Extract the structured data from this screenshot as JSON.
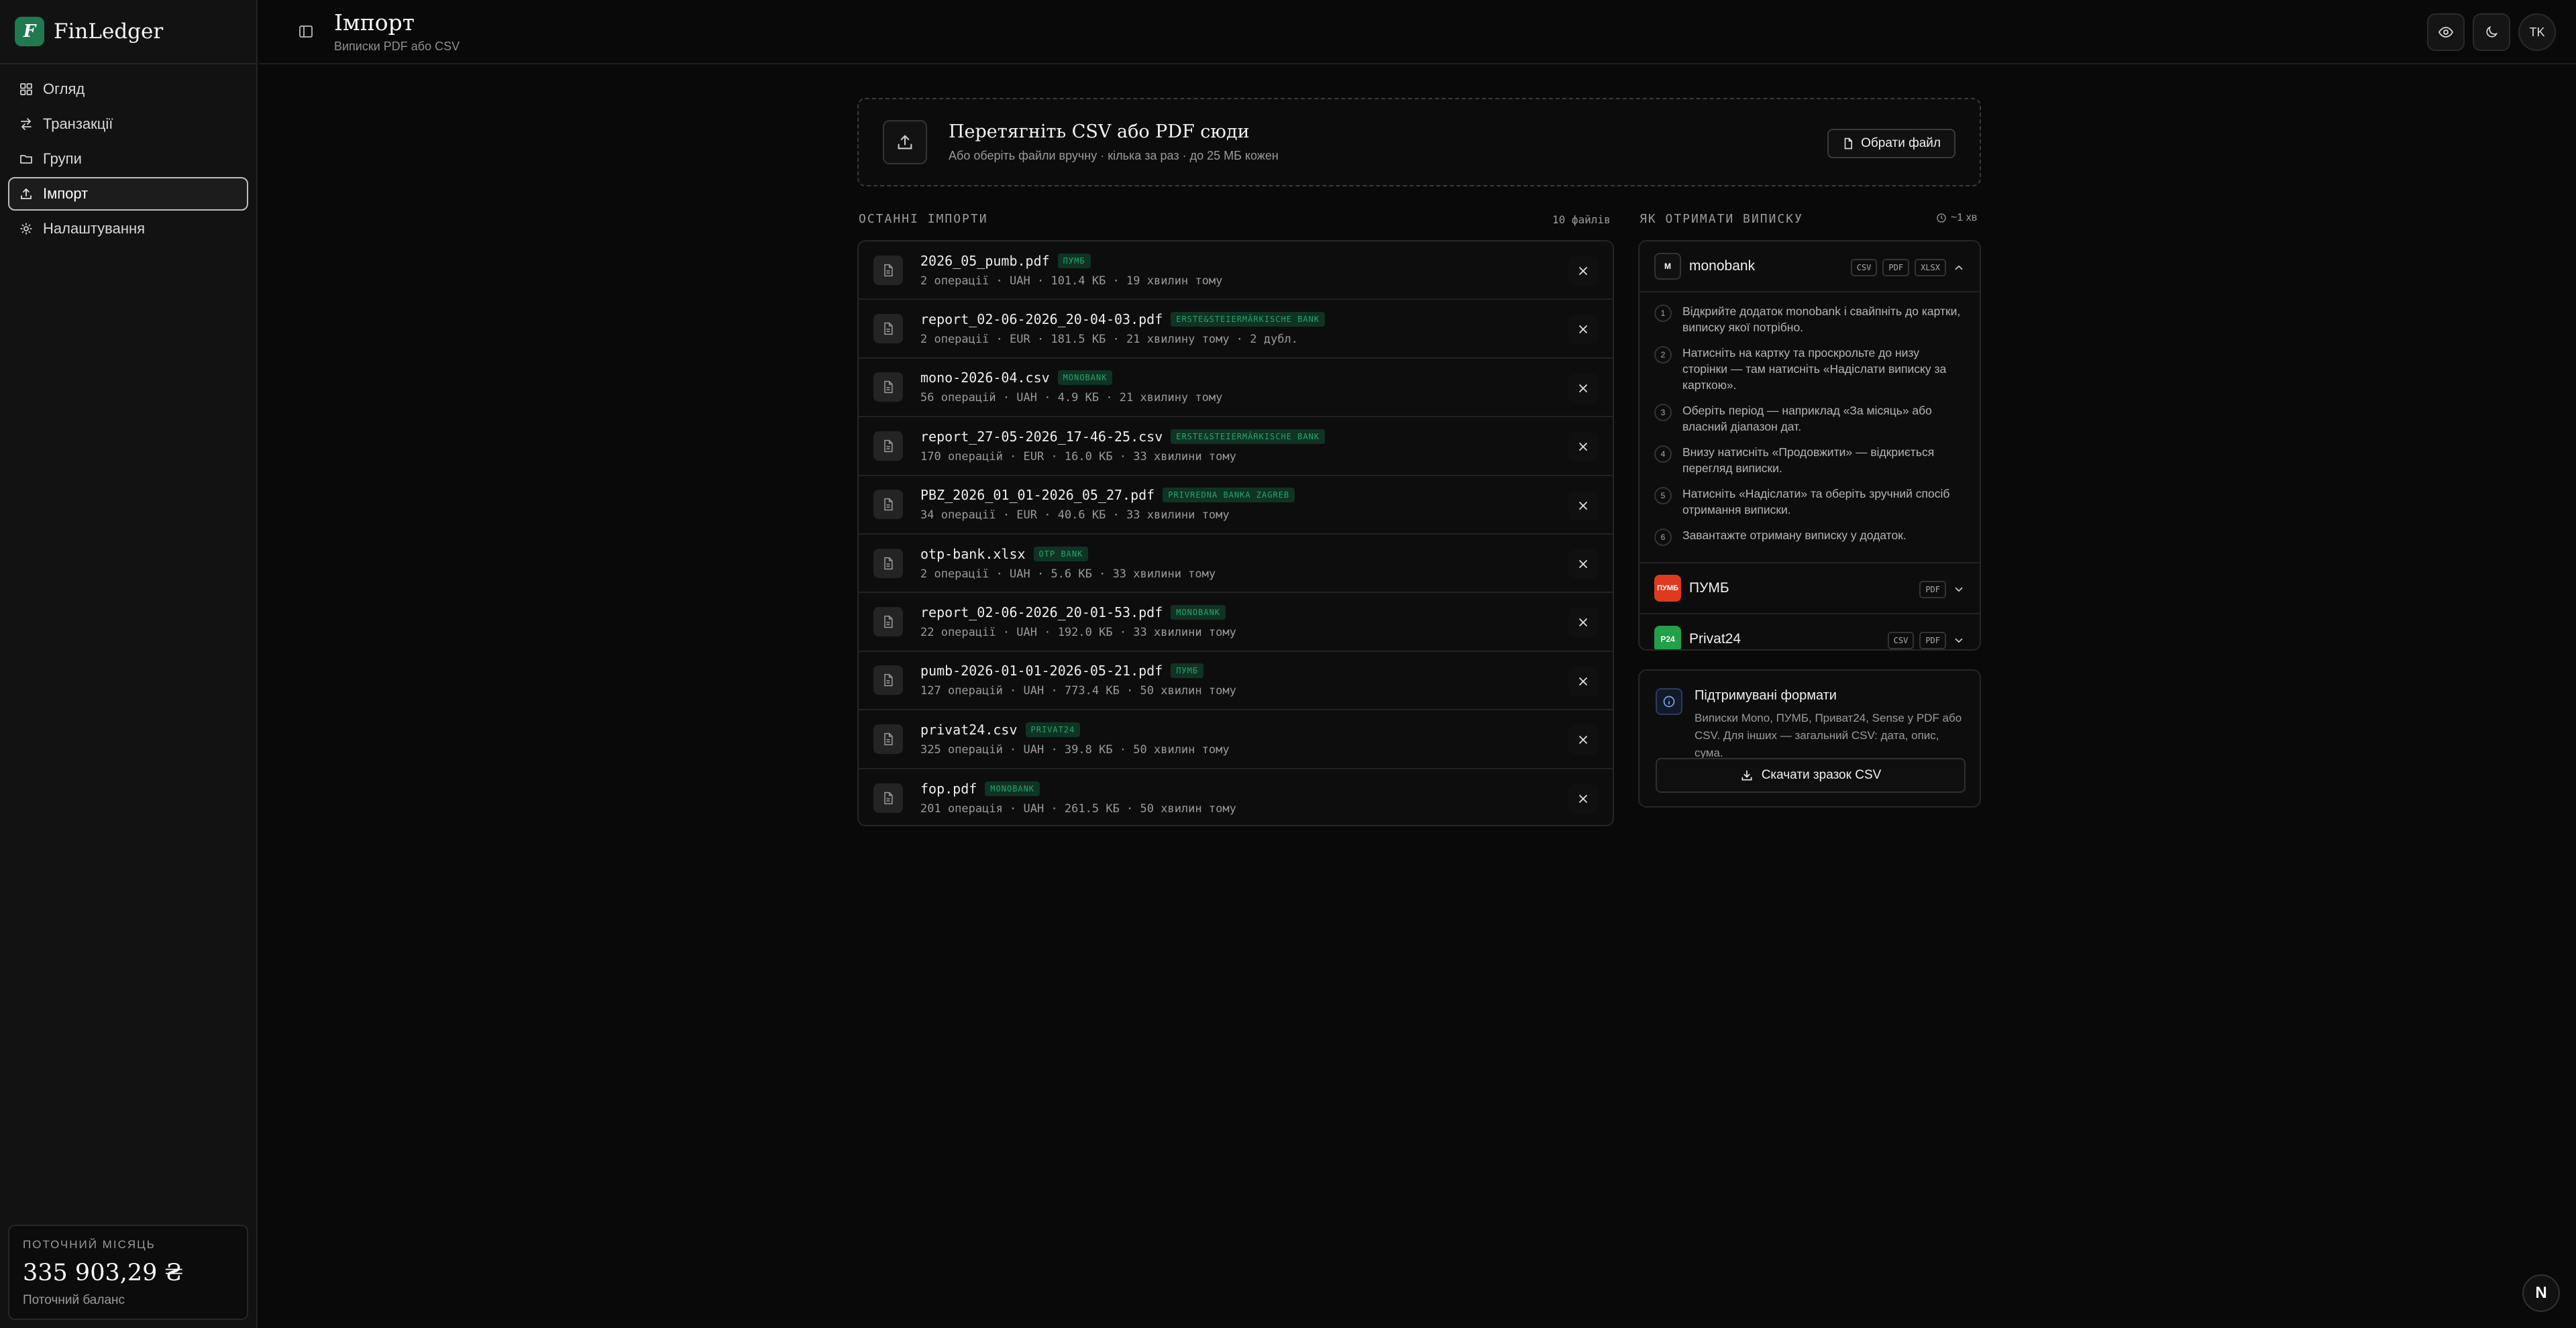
{
  "app": {
    "name": "FinLedger",
    "logo_letter": "F",
    "accent": "#1f7a4f"
  },
  "sidebar": {
    "items": [
      {
        "label": "Огляд",
        "icon": "grid-icon"
      },
      {
        "label": "Транзакції",
        "icon": "arrows-icon"
      },
      {
        "label": "Групи",
        "icon": "folder-icon"
      },
      {
        "label": "Імпорт",
        "icon": "upload-icon",
        "active": true
      },
      {
        "label": "Налаштування",
        "icon": "gear-icon"
      }
    ],
    "balance": {
      "label": "ПОТОЧНИЙ МІСЯЦЬ",
      "value": "335 903,29 ₴",
      "sub": "Поточний баланс"
    }
  },
  "header": {
    "title": "Імпорт",
    "subtitle": "Виписки PDF або CSV",
    "avatar": "TK"
  },
  "dropzone": {
    "title": "Перетягніть CSV або PDF сюди",
    "subtitle": "Або оберіть файли вручну · кілька за раз · до 25 МБ кожен",
    "button": "Обрати файл"
  },
  "imports": {
    "label": "ОСТАННІ ІМПОРТИ",
    "count": "10 файлів",
    "rows": [
      {
        "name": "2026_05_pumb.pdf",
        "badge": "ПУМБ",
        "meta": "2 операції · UAH · 101.4 КБ · 19 хвилин тому"
      },
      {
        "name": "report_02-06-2026_20-04-03.pdf",
        "badge": "ERSTE&STEIERMÄRKISCHE BANK",
        "meta": "2 операції · EUR · 181.5 КБ · 21 хвилину тому · 2 дубл."
      },
      {
        "name": "mono-2026-04.csv",
        "badge": "MONOBANK",
        "meta": "56 операцій · UAH · 4.9 КБ · 21 хвилину тому"
      },
      {
        "name": "report_27-05-2026_17-46-25.csv",
        "badge": "ERSTE&STEIERMÄRKISCHE BANK",
        "meta": "170 операцій · EUR · 16.0 КБ · 33 хвилини тому"
      },
      {
        "name": "PBZ_2026_01_01-2026_05_27.pdf",
        "badge": "PRIVREDNA BANKA ZAGREB",
        "meta": "34 операції · EUR · 40.6 КБ · 33 хвилини тому"
      },
      {
        "name": "otp-bank.xlsx",
        "badge": "OTP BANK",
        "meta": "2 операції · UAH · 5.6 КБ · 33 хвилини тому"
      },
      {
        "name": "report_02-06-2026_20-01-53.pdf",
        "badge": "MONOBANK",
        "meta": "22 операції · UAH · 192.0 КБ · 33 хвилини тому"
      },
      {
        "name": "pumb-2026-01-01-2026-05-21.pdf",
        "badge": "ПУМБ",
        "meta": "127 операцій · UAH · 773.4 КБ · 50 хвилин тому"
      },
      {
        "name": "privat24.csv",
        "badge": "PRIVAT24",
        "meta": "325 операцій · UAH · 39.8 КБ · 50 хвилин тому"
      },
      {
        "name": "fop.pdf",
        "badge": "MONOBANK",
        "meta": "201 операція · UAH · 261.5 КБ · 50 хвилин тому"
      }
    ]
  },
  "howto": {
    "label": "ЯК ОТРИМАТИ ВИПИСКУ",
    "time": "~1 хв",
    "banks": [
      {
        "name": "monobank",
        "logo": "M",
        "logo_color": "#111111",
        "formats": [
          "CSV",
          "PDF",
          "XLSX"
        ],
        "expanded": true,
        "steps": [
          {
            "n": "1",
            "text": "Відкрийте додаток monobank і свайпніть до картки, виписку якої потрібно."
          },
          {
            "n": "2",
            "text": "Натисніть на картку та проскрольте до низу сторінки — там натисніть «Надіслати виписку за карткою»."
          },
          {
            "n": "3",
            "text": "Оберіть період — наприклад «За місяць» або власний діапазон дат."
          },
          {
            "n": "4",
            "text": "Внизу натисніть «Продовжити» — відкриється перегляд виписки."
          },
          {
            "n": "5",
            "text": "Натисніть «Надіслати» та оберіть зручний спосіб отримання виписки."
          },
          {
            "n": "6",
            "text": "Завантажте отриману виписку у додаток."
          }
        ]
      },
      {
        "name": "ПУМБ",
        "logo": "ПУМБ",
        "logo_color": "#e03a1e",
        "formats": [
          "PDF"
        ]
      },
      {
        "name": "Privat24",
        "logo": "P24",
        "logo_color": "#23a04a",
        "formats": [
          "CSV",
          "PDF"
        ]
      }
    ]
  },
  "formats": {
    "title": "Підтримувані формати",
    "text": "Виписки Mono, ПУМБ, Приват24, Sense у PDF або CSV. Для інших — загальний CSV: дата, опис, сума.",
    "button": "Скачати зразок CSV"
  },
  "corner_badge": "N"
}
